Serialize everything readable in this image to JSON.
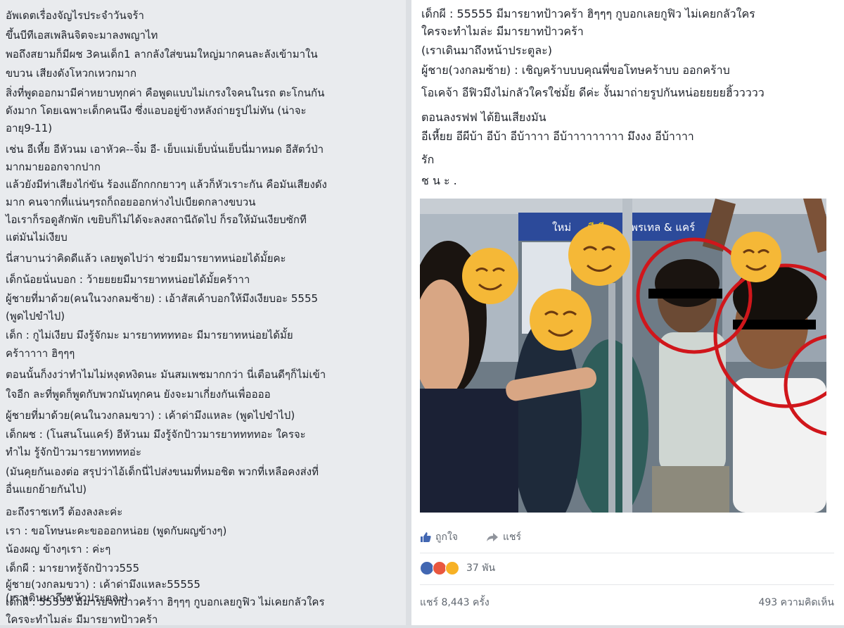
{
  "left_text": [
    "อัพเดตเรื่องจัญไรประจำวันจร้า",
    "ขึ้นบีทีเอสเพลินจิตจะมาลงพญาไท",
    "พอถึงสยามก็มีผช 3คนเด็ก1 ลากลังใส่ขนมใหญ่มากคนละลังเข้ามาใน",
    "ขบวน เสียงดังโหวกเหวกมาก",
    "สิ่งที่พูดออกมามีค่าหยาบทุกค่า คือพูดแบบไม่เกรงใจคนในรถ ตะโกนกัน",
    "ดังมาก โดยเฉพาะเด็กคนนึง ซึ่งแอบอยู่ข้างหลังถ่ายรูปไม่ทัน (น่าจะ",
    "อายุ9-11)",
    "เช่น อีเหี้ย อีหัวนม เอาหัวค--จิ๋ม อี- เย็บแม่เย็บนั่นเย็บนี่มาหมด อีสัตว์ป่า",
    "มากมายออกจากปาก",
    "แล้วยังมีท่าเสียงไก่ขัน ร้องแอ๊กกกกยาวๆ แล้วก็หัวเราะกัน คือมันเสียงดัง",
    "มาก คนจากที่แน่นๆรถก็ถอยออกห่างไปเบียดกลางขบวน",
    "ไอเราก็รอดูสักพัก เขยิบก็ไม่ได้จะลงสถานีถัดไป ก็รอให้มันเงียบซักที",
    "แต่มันไม่เงียบ",
    "นี่สาบานว่าคิดดีแล้ว เลยพูดไปว่า ช่วยมีมารยาทหน่อยได้มั้ยคะ",
    "เด็กน้อยนั่นบอก : ว้ายยยยมีมารยาทหน่อยได้มั้ยคร้าาา",
    "ผู้ชายที่มาด้วย(คนในวงกลมซ้าย) : เอ้าสัสเค้าบอกให้มึงเงียบอะ 5555",
    "(พูดไปขำไป)",
    "เด็ก : กูไม่เงียบ มึงรู้จักมะ มารยาททททอะ มีมารยาทหน่อยได้มั้ย",
    "คร้าาาาา ฮิๆๆๆ",
    "ตอนนั้นก็งงว่าทำไมไม่หงุดหงิดนะ มันสมเพชมากกว่า นี่เตือนดีๆก็ไม่เข้า",
    "ใจอีก ละที่พูดก็พูดกับพวกมันทุกคน ยังจะมาเกี่ยงกันเพื่ออออ",
    "ผู้ชายที่มาด้วย(คนในวงกลมขวา) : เค้าด่ามึงแหละ (พูดไปขำไป)",
    "เด็กผช : (โนสนโนแคร์) อีหัวนม มึงรู้จักป้าวมารยาททททอะ ใครจะ",
    "ทำไม รู้จักป้าวมารยาททททอ่ะ",
    "(มันคุยกันเองต่อ สรุปว่าไอ้เด็กนี่ไปส่งขนมที่หมอชิต พวกที่เหลือคงส่งที่",
    "อื่นแยกย้ายกันไป)",
    "อะถึงราชเทวี ต้องลงละค่ะ",
    "เรา : ขอโทษนะคะขอออกหน่อย (พูดกับผญข้างๆ)",
    "น้องผญ ข้างๆเรา : ค่ะๆ",
    "เด็กผี : มารยาทรู้จักป้าวว555",
    "ผู้ชาย(วงกลมขวา) : เค้าด่ามึงแหละ55555",
    "เด็กผี : 55555 มีมารยาทป้าวคร้าา ฮิๆๆๆ กูบอกเลยกูฟิว ไม่เคยกลัวใคร",
    "ใครจะทำไมล่ะ มีมารยาทป้าวคร้า",
    "(เราเดินมาถึงหน้าประตูละ)"
  ],
  "right_text": [
    "เด็กผี : 55555 มีมารยาทป้าวคร้า ฮิๆๆๆ กูบอกเลยกูฟิว ไม่เคยกลัวใคร",
    "ใครจะทำไมล่ะ มีมารยาทป้าวคร้า",
    "(เราเดินมาถึงหน้าประตูละ)",
    "ผู้ชาย(วงกลมซ้าย) : เชิญคร้าบบบคุณพี่ขอโทษคร้าบบ ออกคร้าบ",
    "โอเคจ้า อีฟิวมึงไม่กลัวใครใช่มั้ย ดีค่ะ งั้นมาถ่ายรูปกันหน่อยยยยฮิ้ววววว",
    "ตอนลงรฟฟ ได้ยินเสียงมัน",
    "อีเหี้ยย อีผีบ้า อีบ้า อีบ้าาาา อีบ้าาาาาาาาา มึงงง อีบ้าาาา",
    "รัก",
    "ช น ะ ."
  ],
  "photo": {
    "sign_left": "ใหม่",
    "sign_mid": "มีเฉี",
    "sign_right": "พรเทล & แคร์"
  },
  "actions": {
    "like": "ถูกใจ",
    "share": "แชร์"
  },
  "reactions": {
    "count": "37 พัน"
  },
  "stats": {
    "shares": "แชร์ 8,443 ครั้ง",
    "comments": "493 ความคิดเห็น"
  },
  "colors": {
    "left_bg": "#e9ebee",
    "circle": "#d0161b",
    "like_blue": "#4267b2"
  }
}
